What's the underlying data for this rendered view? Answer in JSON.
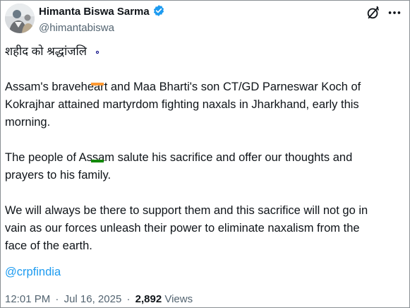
{
  "post": {
    "author": {
      "display_name": "Himanta Biswa Sarma",
      "handle": "@himantabiswa",
      "verified_icon": "verified-badge-icon",
      "verified_color": "#1d9bf0"
    },
    "header_icons": {
      "grok": "grok-icon",
      "more": "more-options-icon"
    },
    "body": {
      "line1": "शहीद को श्रद्धांजलि",
      "flag_icon": "indian-flag-icon",
      "paragraph1": "Assam's braveheart and Maa Bharti's son CT/GD Parneswar Koch of\nKokrajhar attained martyrdom fighting naxals in Jharkhand, early this\nmorning.",
      "paragraph2": "The people of Assam salute his sacrifice and offer our thoughts and\nprayers to his family.",
      "paragraph3": "We will always be there to support them and this sacrifice will not go in\nvain as our forces unleash their power to eliminate naxalism from the\nface of the earth.",
      "mention": "@crpfindia"
    },
    "meta": {
      "time": "12:01 PM",
      "separator": "·",
      "date": "Jul 16, 2025",
      "views_count": "2,892",
      "views_label": "Views"
    }
  },
  "colors": {
    "text": "#0f1419",
    "secondary": "#536471",
    "link": "#1d9bf0"
  }
}
